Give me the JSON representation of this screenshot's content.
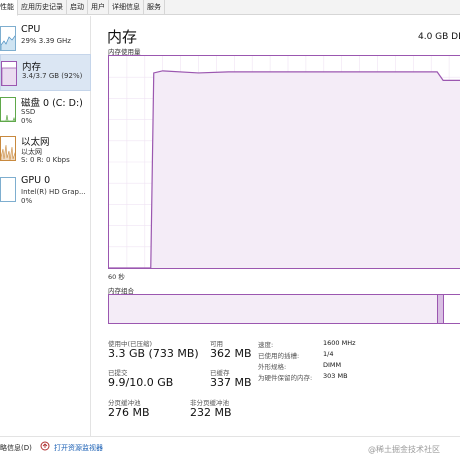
{
  "tabs": [
    "性能",
    "应用历史记录",
    "启动",
    "用户",
    "详细信息",
    "服务"
  ],
  "sidebar": {
    "items": [
      {
        "title": "CPU",
        "sub1": "29%  3.39 GHz",
        "sub2": ""
      },
      {
        "title": "内存",
        "sub1": "3.4/3.7 GB (92%)",
        "sub2": ""
      },
      {
        "title": "磁盘 0 (C: D:)",
        "sub1": "SSD",
        "sub2": "0%"
      },
      {
        "title": "以太网",
        "sub1": "以太网",
        "sub2": "S: 0  R: 0 Kbps"
      },
      {
        "title": "GPU 0",
        "sub1": "Intel(R) HD Grap...",
        "sub2": "0%"
      }
    ]
  },
  "main": {
    "title": "内存",
    "capacity": "4.0 GB DD",
    "usage_label": "内存使用量",
    "time_label": "60 秒",
    "composition_label": "内存组合"
  },
  "stats": {
    "in_use_label": "使用中(已压缩)",
    "in_use_value": "3.3 GB (733 MB)",
    "available_label": "可用",
    "available_value": "362 MB",
    "committed_label": "已提交",
    "committed_value": "9.9/10.0 GB",
    "cached_label": "已缓存",
    "cached_value": "337 MB",
    "paged_label": "分页缓冲池",
    "paged_value": "276 MB",
    "nonpaged_label": "非分页缓冲池",
    "nonpaged_value": "232 MB"
  },
  "properties": [
    {
      "label": "速度:",
      "value": "1600 MHz"
    },
    {
      "label": "已使用的插槽:",
      "value": "1/4"
    },
    {
      "label": "外形规格:",
      "value": "DIMM"
    },
    {
      "label": "为硬件保留的内存:",
      "value": "303 MB"
    }
  ],
  "footer": {
    "summary": "略信息(D)",
    "link": "打开资源监视器",
    "watermark": "@稀土掘金技术社区"
  },
  "chart_data": {
    "type": "area",
    "title": "内存使用量",
    "xlabel": "60 秒",
    "ylabel": "",
    "x_seconds_ago": [
      60,
      53,
      52.5,
      51,
      45,
      40,
      30,
      20,
      10,
      5,
      4,
      0
    ],
    "values_percent": [
      0,
      0,
      92,
      93,
      92,
      92.5,
      92.5,
      92.5,
      92.5,
      92.5,
      88.5,
      88.5
    ],
    "xlim": [
      60,
      0
    ],
    "ylim": [
      0,
      100
    ],
    "grid": true,
    "color": "#9b57b0"
  },
  "composition": {
    "in_use_fraction": 0.92,
    "modified_fraction": 0.015,
    "standby_fraction": 0.075,
    "color": "#9b57b0"
  },
  "colors": {
    "accent": "#9b57b0",
    "fill": "#f4ecf7",
    "selected": "#dbe6f3",
    "link": "#1a5fb4"
  }
}
